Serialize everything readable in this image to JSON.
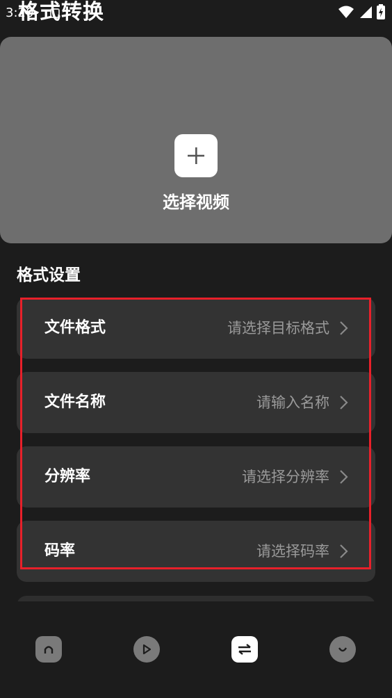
{
  "status_bar": {
    "time": "3:20"
  },
  "page": {
    "title": "格式转换"
  },
  "upload": {
    "label": "选择视频",
    "icon": "plus-icon"
  },
  "settings": {
    "section_title": "格式设置",
    "rows": [
      {
        "label": "文件格式",
        "placeholder": "请选择目标格式"
      },
      {
        "label": "文件名称",
        "placeholder": "请输入名称"
      },
      {
        "label": "分辨率",
        "placeholder": "请选择分辨率"
      },
      {
        "label": "码率",
        "placeholder": "请选择码率"
      }
    ]
  },
  "bottom_nav": {
    "items": [
      {
        "icon": "home-icon",
        "active": false
      },
      {
        "icon": "play-icon",
        "active": false
      },
      {
        "icon": "convert-icon",
        "active": true
      },
      {
        "icon": "profile-icon",
        "active": false
      }
    ]
  },
  "colors": {
    "background": "#1c1c1c",
    "upload_area": "#6e6e6e",
    "row_background": "#333333",
    "placeholder_text": "#9a9a9a",
    "highlight": "#e8202a"
  }
}
